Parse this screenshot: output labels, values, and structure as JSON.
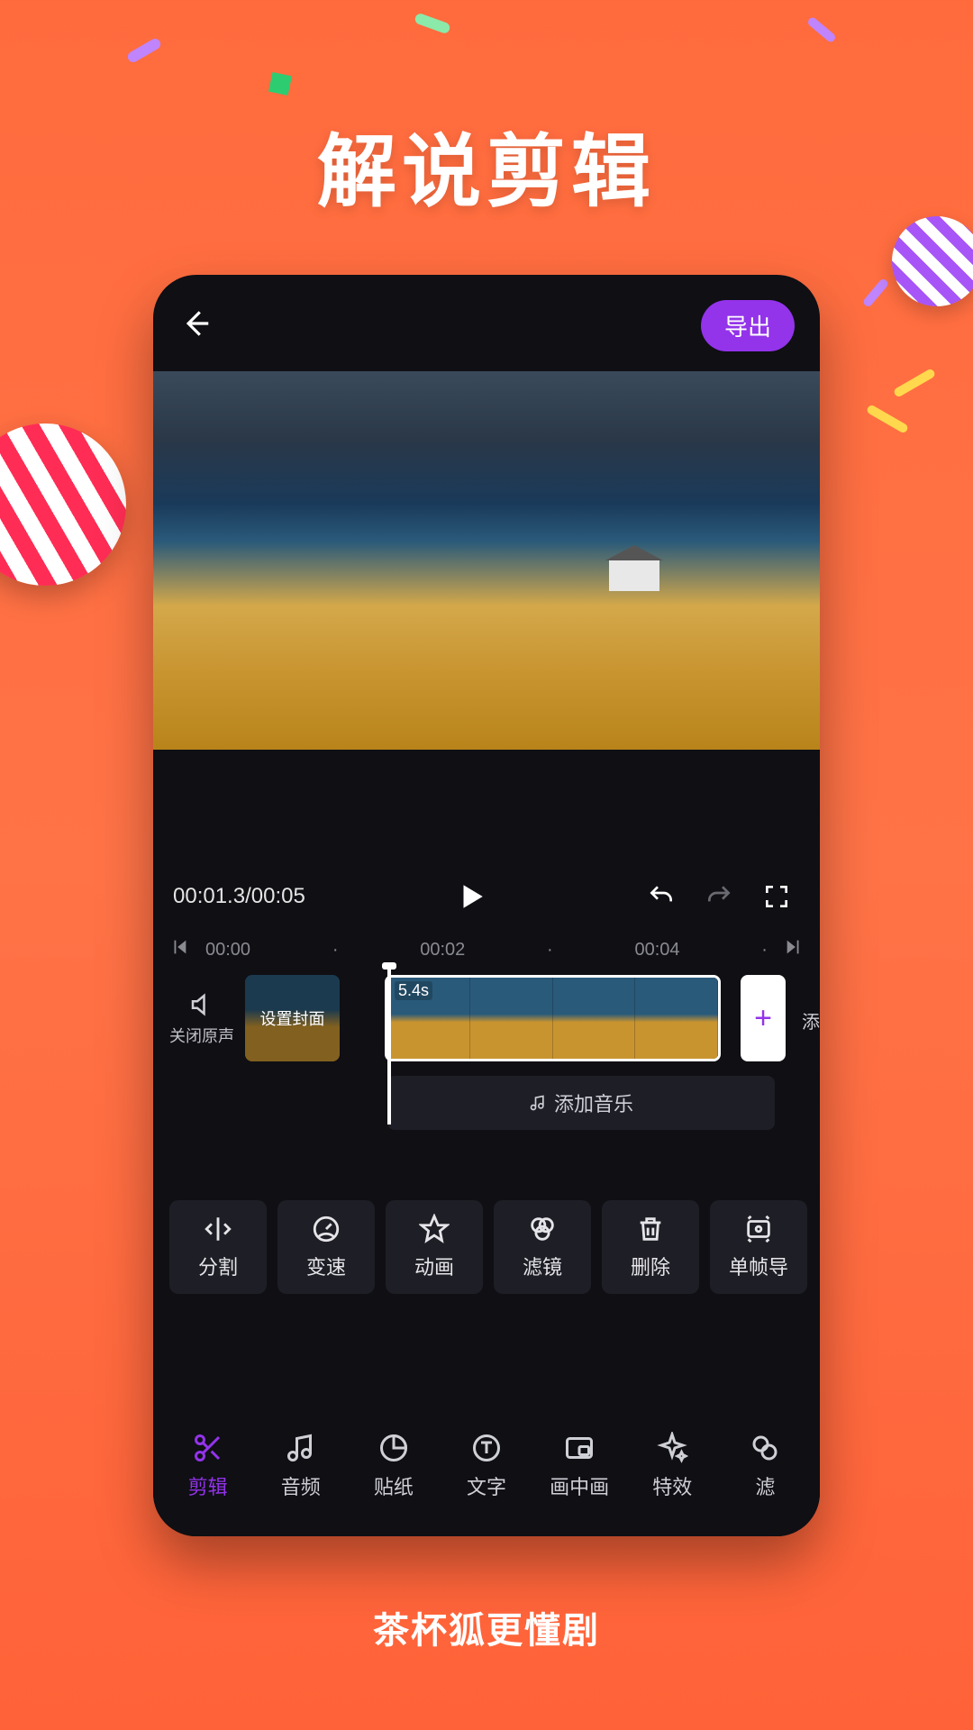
{
  "hero": {
    "title": "解说剪辑"
  },
  "footer": {
    "tagline": "茶杯狐更懂剧"
  },
  "header": {
    "export_label": "导出"
  },
  "playback": {
    "time": "00:01.3/00:05",
    "ruler": [
      "00:00",
      "00:02",
      "00:04"
    ]
  },
  "track": {
    "mute_label": "关闭原声",
    "cover_label": "设置封面",
    "clip_duration": "5.4s",
    "add_label": "添"
  },
  "music": {
    "add_label": "添加音乐"
  },
  "tools": [
    {
      "label": "分割"
    },
    {
      "label": "变速"
    },
    {
      "label": "动画"
    },
    {
      "label": "滤镜"
    },
    {
      "label": "删除"
    },
    {
      "label": "单帧导"
    }
  ],
  "nav": [
    {
      "label": "剪辑",
      "active": true
    },
    {
      "label": "音频",
      "active": false
    },
    {
      "label": "贴纸",
      "active": false
    },
    {
      "label": "文字",
      "active": false
    },
    {
      "label": "画中画",
      "active": false
    },
    {
      "label": "特效",
      "active": false
    },
    {
      "label": "滤",
      "active": false
    }
  ]
}
